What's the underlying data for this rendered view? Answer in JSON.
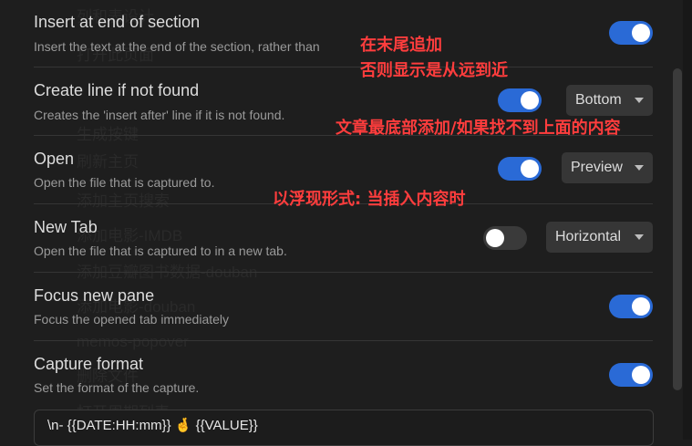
{
  "settings": [
    {
      "name": "Insert at end of section",
      "desc": "Insert the text at the end of the section, rather than",
      "toggle": "on"
    },
    {
      "name": "Create line if not found",
      "desc": "Creates the 'insert after' line if it is not found.",
      "toggle": "on",
      "dropdown": "Bottom"
    },
    {
      "name": "Open",
      "desc": "Open the file that is captured to.",
      "toggle": "on",
      "dropdown": "Preview"
    },
    {
      "name": "New Tab",
      "desc": "Open the file that is captured to in a new tab.",
      "toggle": "off",
      "dropdown": "Horizontal"
    },
    {
      "name": "Focus new pane",
      "desc": "Focus the opened tab immediately",
      "toggle": "on"
    },
    {
      "name": "Capture format",
      "desc": "Set the format of the capture.",
      "toggle": "on"
    }
  ],
  "capture_format_value": "\\n- {{DATE:HH:mm}} 🤞 {{VALUE}}",
  "annotations": [
    "在末尾追加",
    "否则显示是从远到近",
    "文章最底部添加/如果找不到上面的内容",
    "以浮现形式: 当插入内容时"
  ],
  "background_ghost_text": [
    "列和表设计",
    "打开此页面",
    "生成按键",
    "刷新主页",
    "添加主页搜索",
    "添加电影-IMDB",
    "添加豆瓣图书数据-douban",
    "添加电影-douban",
    "memos-popover",
    "删除文件",
    "打开周期列表"
  ],
  "colors": {
    "background": "#1e1e1e",
    "toggle_on": "#2a6ad6",
    "toggle_off": "#3a3a3a",
    "annotation": "#ff3d3d"
  }
}
